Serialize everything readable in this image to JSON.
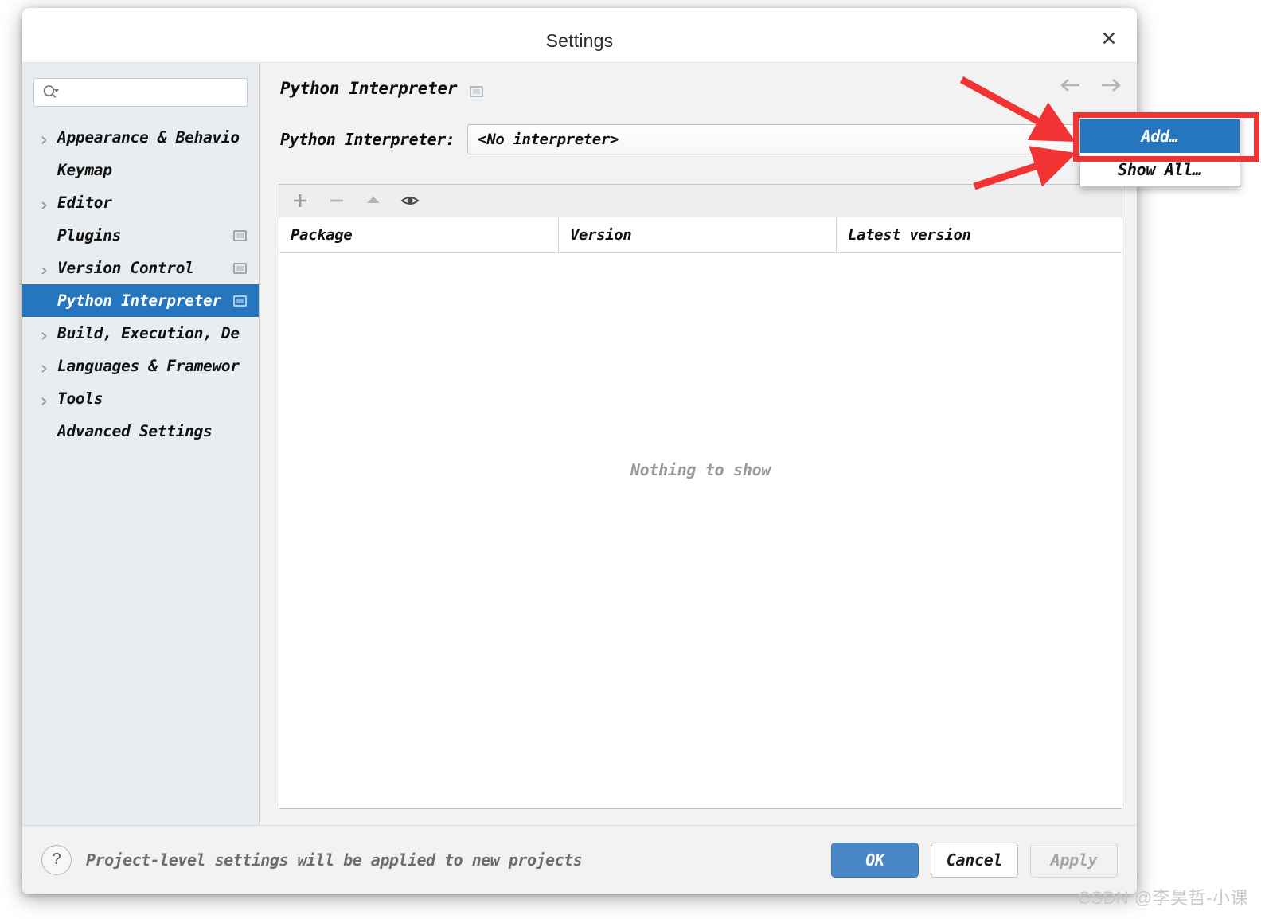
{
  "window": {
    "title": "Settings",
    "close_icon": "close-icon"
  },
  "sidebar": {
    "search": {
      "value": "",
      "placeholder": "",
      "icon": "search-icon"
    },
    "items": [
      {
        "label": "Appearance & Behavio",
        "expandable": true,
        "badge": false,
        "selected": false
      },
      {
        "label": "Keymap",
        "expandable": false,
        "badge": false,
        "selected": false
      },
      {
        "label": "Editor",
        "expandable": true,
        "badge": false,
        "selected": false
      },
      {
        "label": "Plugins",
        "expandable": false,
        "badge": true,
        "selected": false
      },
      {
        "label": "Version Control",
        "expandable": true,
        "badge": true,
        "selected": false
      },
      {
        "label": "Python Interpreter",
        "expandable": false,
        "badge": true,
        "selected": true
      },
      {
        "label": "Build, Execution, De",
        "expandable": true,
        "badge": false,
        "selected": false
      },
      {
        "label": "Languages & Framewor",
        "expandable": true,
        "badge": false,
        "selected": false
      },
      {
        "label": "Tools",
        "expandable": true,
        "badge": false,
        "selected": false
      },
      {
        "label": "Advanced Settings",
        "expandable": false,
        "badge": false,
        "selected": false
      }
    ]
  },
  "content": {
    "page_title": "Python Interpreter",
    "nav": {
      "back_icon": "arrow-left-icon",
      "forward_icon": "arrow-right-icon"
    },
    "interpreter": {
      "label": "Python Interpreter:",
      "value": "<No interpreter>",
      "dropdown_icon": "chevron-down-icon"
    },
    "packages": {
      "toolbar": [
        {
          "name": "add-package-button",
          "glyph": "+"
        },
        {
          "name": "remove-package-button",
          "glyph": "−"
        },
        {
          "name": "upgrade-package-button",
          "glyph": "▲"
        },
        {
          "name": "show-early-releases-button",
          "glyph": "eye"
        }
      ],
      "columns": [
        "Package",
        "Version",
        "Latest version"
      ],
      "rows": [],
      "empty_text": "Nothing to show"
    }
  },
  "popup": {
    "items": [
      {
        "label": "Add…",
        "highlighted": true
      },
      {
        "label": "Show All…",
        "highlighted": false
      }
    ]
  },
  "footer": {
    "help_icon": "?",
    "note": "Project-level settings will be applied to new projects",
    "buttons": [
      {
        "label": "OK",
        "style": "primary"
      },
      {
        "label": "Cancel",
        "style": "normal"
      },
      {
        "label": "Apply",
        "style": "disabled"
      }
    ]
  },
  "annotations": {
    "highlight_color": "#f23333",
    "arrows": 2
  },
  "watermark": {
    "text": "CSDN @李昊哲-小课"
  }
}
